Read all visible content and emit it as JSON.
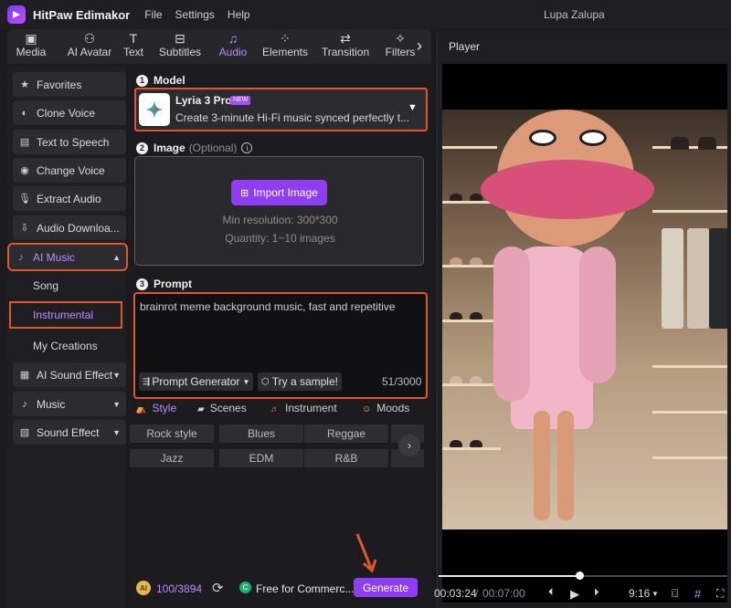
{
  "app": {
    "name": "HitPaw Edimakor",
    "window_title": "Lupa Zalupa",
    "menu": [
      "File",
      "Settings",
      "Help"
    ]
  },
  "toolbar": {
    "tabs": [
      {
        "label": "Media",
        "icon": "image-icon"
      },
      {
        "label": "AI Avatar",
        "icon": "person-plus-icon"
      },
      {
        "label": "Text",
        "icon": "text-icon"
      },
      {
        "label": "Subtitles",
        "icon": "subtitles-icon"
      },
      {
        "label": "Audio",
        "icon": "music-note-icon"
      },
      {
        "label": "Elements",
        "icon": "elements-icon"
      },
      {
        "label": "Transition",
        "icon": "transition-icon"
      },
      {
        "label": "Filters",
        "icon": "sparkle-icon"
      }
    ],
    "active": "Audio"
  },
  "sidebar": {
    "items": [
      {
        "label": "Favorites",
        "icon": "star-icon"
      },
      {
        "label": "Clone Voice",
        "icon": "clone-voice-icon"
      },
      {
        "label": "Text to Speech",
        "icon": "text-to-speech-icon"
      },
      {
        "label": "Change Voice",
        "icon": "change-voice-icon"
      },
      {
        "label": "Extract Audio",
        "icon": "microphone-icon"
      },
      {
        "label": "Audio Downloa...",
        "icon": "download-icon"
      },
      {
        "label": "AI Music",
        "icon": "ai-music-icon"
      }
    ],
    "ai_music_subitems": [
      "Song",
      "Instrumental",
      "My Creations"
    ],
    "lower_items": [
      {
        "label": "AI Sound Effect",
        "icon": "ai-sound-effect-icon"
      },
      {
        "label": "Music",
        "icon": "music-icon"
      },
      {
        "label": "Sound Effect",
        "icon": "sound-effect-icon"
      }
    ]
  },
  "model": {
    "section_number": "1",
    "section_label": "Model",
    "name": "Lyria 3 Pro",
    "badge": "NEW",
    "description": "Create 3-minute Hi-Fi music synced perfectly t..."
  },
  "image": {
    "section_number": "2",
    "section_label": "Image",
    "optional": "(Optional)",
    "import_label": "Import Image",
    "min_resolution": "Min resolution: 300*300",
    "quantity": "Quantity: 1~10 images"
  },
  "prompt": {
    "section_number": "3",
    "section_label": "Prompt",
    "value": "brainrot meme background music, fast and repetitive",
    "generator_label": "Prompt Generator",
    "sample_label": "Try a sample!",
    "count": "51/3000"
  },
  "style_tabs": [
    "Style",
    "Scenes",
    "Instrument",
    "Moods"
  ],
  "style_chips": [
    [
      "Rock style",
      "Blues",
      "Reggae"
    ],
    [
      "Jazz",
      "EDM",
      "R&B"
    ]
  ],
  "bottom": {
    "credits": "100/3894",
    "free_label": "Free for Commerc...",
    "generate_label": "Generate"
  },
  "player": {
    "title": "Player",
    "current_time": "00:03:24",
    "total_time": "00:07:00",
    "aspect": "9:16",
    "progress": 0.486
  },
  "colors": {
    "accent": "#8e3df2",
    "highlight": "#e0572f",
    "active_tab": "#b68cff"
  }
}
